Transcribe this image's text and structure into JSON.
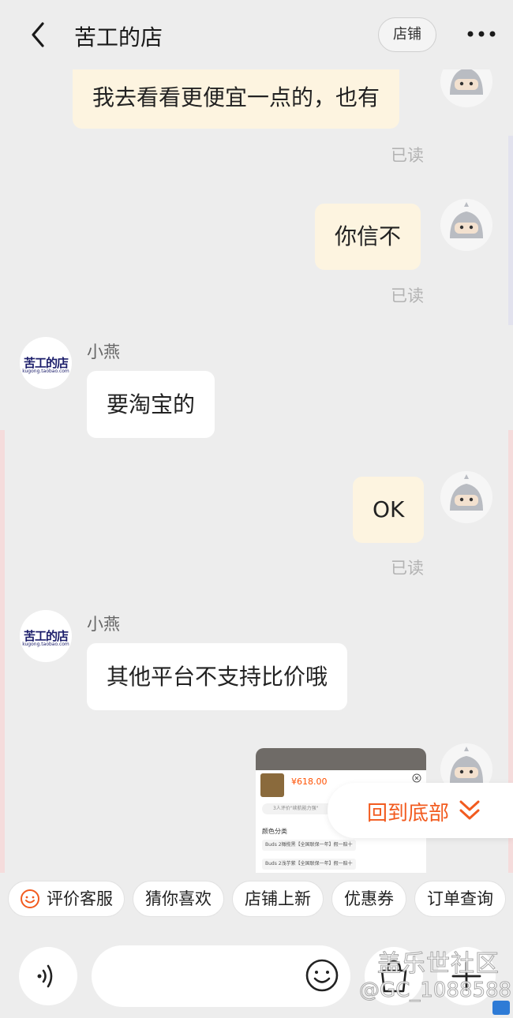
{
  "header": {
    "title": "苦工的店",
    "shop_button": "店铺",
    "back_icon": "chevron-left-icon",
    "more_icon": "more-dots-icon"
  },
  "messages": [
    {
      "side": "me",
      "text": "我去看看更便宜一点的，也有",
      "status": "已读"
    },
    {
      "side": "me",
      "text": "你信不",
      "status": "已读"
    },
    {
      "side": "them",
      "sender": "小燕",
      "text": "要淘宝的"
    },
    {
      "side": "me",
      "text": "OK",
      "status": "已读"
    },
    {
      "side": "them",
      "sender": "小燕",
      "text": "其他平台不支持比价哦"
    }
  ],
  "shop_avatar": {
    "logo_text": "苦工的店",
    "logo_sub": "kugong.taobao.com"
  },
  "product_card": {
    "price": "¥618.00",
    "eval_text": "3人评价\"续航能力强\"",
    "category_label": "颜色分类",
    "options": [
      "Buds 2橄榄黑【全国联保一年】假一赔十",
      "Buds 2浅芋紫【全国联保一年】假一赔十"
    ]
  },
  "back_to_bottom": {
    "label": "回到底部",
    "icon": "double-chevron-down-icon"
  },
  "quick_actions": [
    "评价客服",
    "猜你喜欢",
    "店铺上新",
    "优惠券",
    "订单查询"
  ],
  "input_bar": {
    "voice_icon": "voice-icon",
    "emoji_icon": "emoji-icon",
    "cart_icon": "cart-icon",
    "plus_icon": "plus-icon"
  },
  "watermark": {
    "line1": "盖乐世社区",
    "line2": "@GC_1088588"
  },
  "colors": {
    "accent": "#f25b1f",
    "bubble_me": "#fdf4e0",
    "bubble_them": "#ffffff",
    "background": "#ededed"
  }
}
